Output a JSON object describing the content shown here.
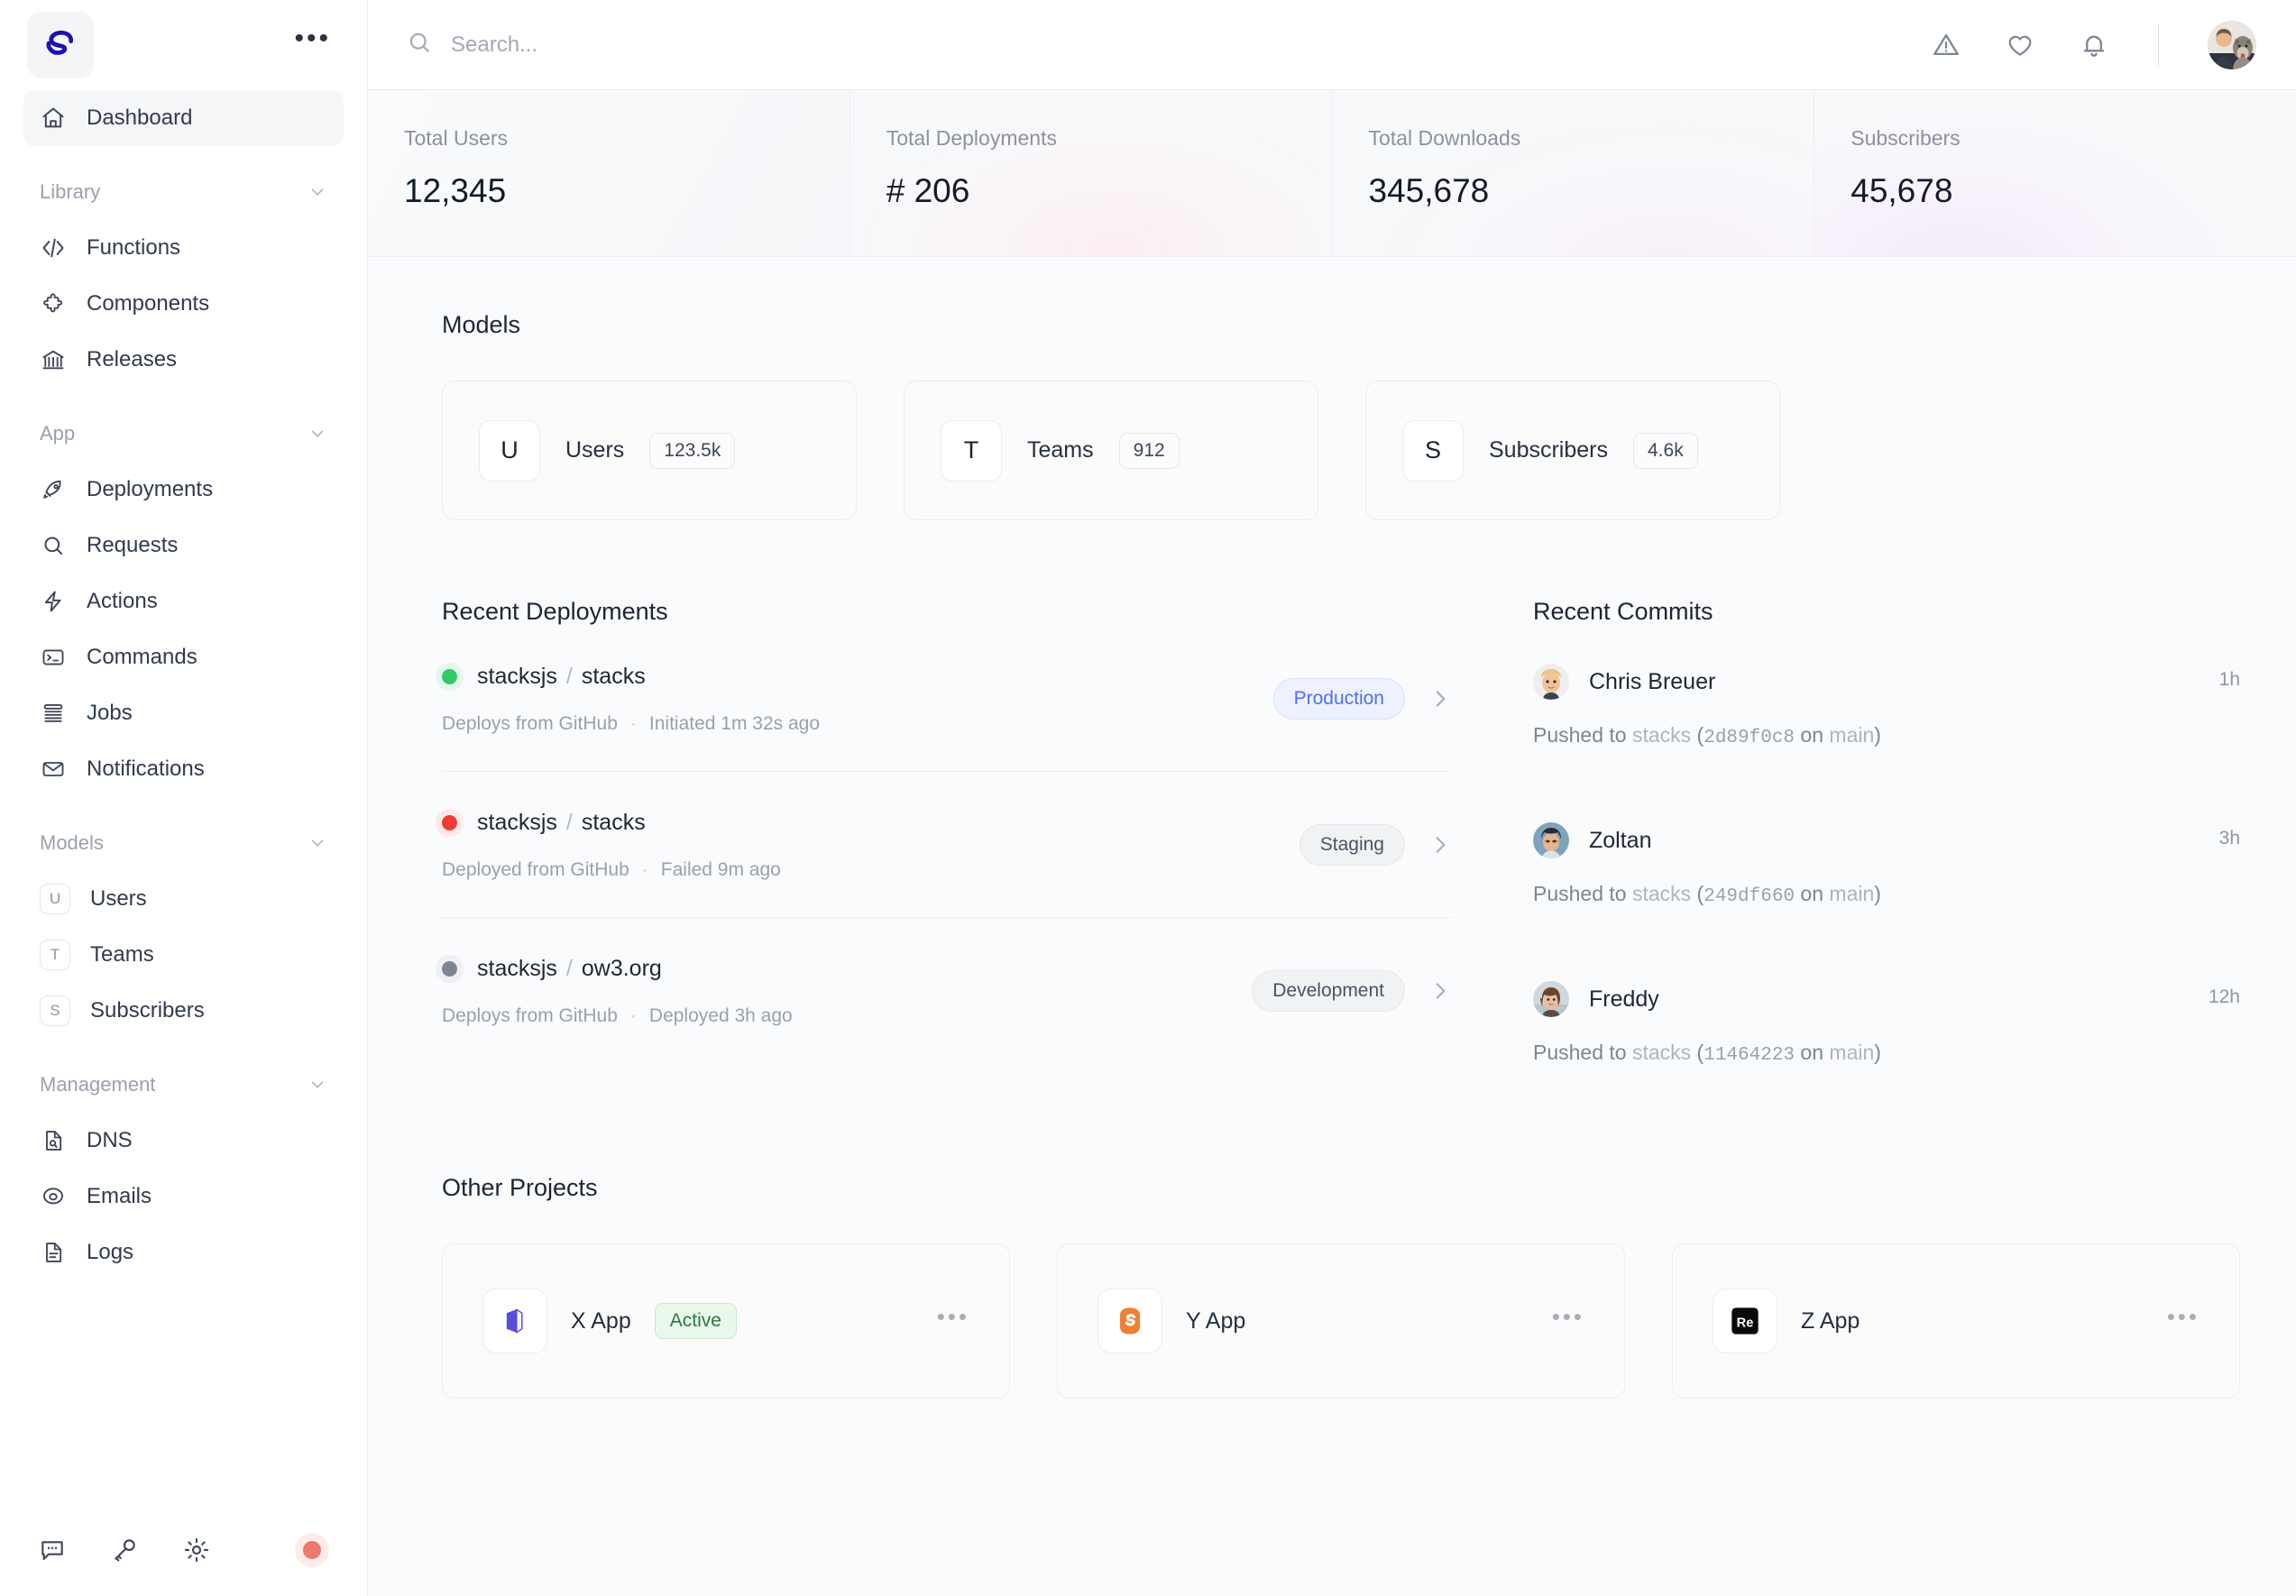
{
  "brand": {
    "logo": "stacks-logo",
    "menu_icon": "ellipsis-icon"
  },
  "sidebar": {
    "primary": [
      {
        "label": "Dashboard",
        "icon": "home-icon",
        "active": true
      }
    ],
    "sections": [
      {
        "title": "Library",
        "items": [
          {
            "label": "Functions",
            "icon": "code-icon"
          },
          {
            "label": "Components",
            "icon": "puzzle-icon"
          },
          {
            "label": "Releases",
            "icon": "bank-icon"
          }
        ]
      },
      {
        "title": "App",
        "items": [
          {
            "label": "Deployments",
            "icon": "rocket-icon"
          },
          {
            "label": "Requests",
            "icon": "search-icon"
          },
          {
            "label": "Actions",
            "icon": "bolt-icon"
          },
          {
            "label": "Commands",
            "icon": "terminal-icon"
          },
          {
            "label": "Jobs",
            "icon": "stack-icon"
          },
          {
            "label": "Notifications",
            "icon": "envelope-icon"
          }
        ]
      },
      {
        "title": "Models",
        "items": [
          {
            "label": "Users",
            "badge": "U"
          },
          {
            "label": "Teams",
            "badge": "T"
          },
          {
            "label": "Subscribers",
            "badge": "S"
          }
        ]
      },
      {
        "title": "Management",
        "items": [
          {
            "label": "DNS",
            "icon": "document-search-icon"
          },
          {
            "label": "Emails",
            "icon": "at-icon"
          },
          {
            "label": "Logs",
            "icon": "document-lines-icon"
          }
        ]
      }
    ],
    "footer_icons": [
      "chat-icon",
      "key-icon",
      "gear-icon",
      "record-dot-icon"
    ]
  },
  "topbar": {
    "search_placeholder": "Search...",
    "search_value": "",
    "icons": [
      "alert-triangle-icon",
      "heart-icon",
      "bell-icon"
    ],
    "avatar": "user-avatar"
  },
  "stats": [
    {
      "label": "Total Users",
      "value": "12,345"
    },
    {
      "label": "Total Deployments",
      "value": "# 206"
    },
    {
      "label": "Total Downloads",
      "value": "345,678"
    },
    {
      "label": "Subscribers",
      "value": "45,678"
    }
  ],
  "models": {
    "title": "Models",
    "cards": [
      {
        "initial": "U",
        "name": "Users",
        "count": "123.5k"
      },
      {
        "initial": "T",
        "name": "Teams",
        "count": "912"
      },
      {
        "initial": "S",
        "name": "Subscribers",
        "count": "4.6k"
      }
    ]
  },
  "deployments": {
    "title": "Recent Deployments",
    "rows": [
      {
        "status": "green",
        "owner": "stacksjs",
        "repo": "stacks",
        "meta_source": "Deploys from GitHub",
        "meta_time": "Initiated 1m 32s ago",
        "env": "Production",
        "env_style": "production"
      },
      {
        "status": "red",
        "owner": "stacksjs",
        "repo": "stacks",
        "meta_source": "Deployed from GitHub",
        "meta_time": "Failed 9m ago",
        "env": "Staging",
        "env_style": "staging"
      },
      {
        "status": "gray",
        "owner": "stacksjs",
        "repo": "ow3.org",
        "meta_source": "Deploys from GitHub",
        "meta_time": "Deployed 3h ago",
        "env": "Development",
        "env_style": "development"
      }
    ]
  },
  "commits": {
    "title": "Recent Commits",
    "rows": [
      {
        "author": "Chris Breuer",
        "time": "1h",
        "prefix": "Pushed to ",
        "repo": "stacks",
        "open": " (",
        "hash": "2d89f0c8",
        "mid": " on ",
        "branch": "main",
        "close": ")"
      },
      {
        "author": "Zoltan",
        "time": "3h",
        "prefix": "Pushed to ",
        "repo": "stacks",
        "open": " (",
        "hash": "249df660",
        "mid": " on ",
        "branch": "main",
        "close": ")"
      },
      {
        "author": "Freddy",
        "time": "12h",
        "prefix": "Pushed to ",
        "repo": "stacks",
        "open": " (",
        "hash": "11464223",
        "mid": " on ",
        "branch": "main",
        "close": ")"
      }
    ]
  },
  "other_projects": {
    "title": "Other Projects",
    "cards": [
      {
        "name": "X App",
        "badge": "Active",
        "icon": "x-app-icon",
        "more": "ellipsis-icon"
      },
      {
        "name": "Y App",
        "badge": "",
        "icon": "y-app-icon",
        "more": "ellipsis-icon"
      },
      {
        "name": "Z App",
        "badge": "",
        "icon": "z-app-icon",
        "icon_text": "Re",
        "more": "ellipsis-icon"
      }
    ]
  },
  "colors": {
    "accent_blue": "#4f6ef7",
    "logo_blue": "#1b10b0",
    "status_green": "#2fc96a",
    "status_red": "#ef3d33",
    "status_gray": "#7d8595",
    "active_green": "#2a7a3d",
    "x_app_purple": "#5b4ddb",
    "y_app_orange": "#ef7f33"
  }
}
